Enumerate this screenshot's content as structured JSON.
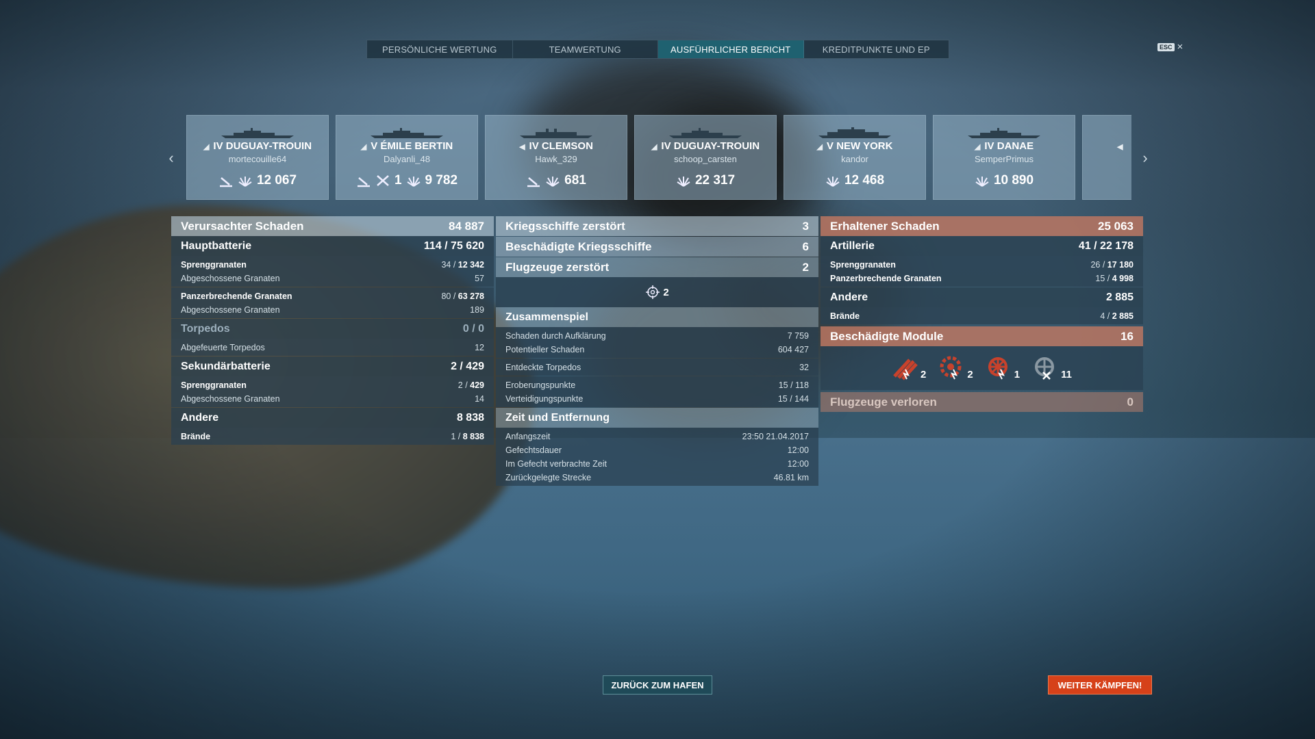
{
  "tabs": [
    {
      "label": "PERSÖNLICHE WERTUNG"
    },
    {
      "label": "TEAMWERTUNG"
    },
    {
      "label": "AUSFÜHRLICHER BERICHT",
      "active": true
    },
    {
      "label": "KREDITPUNKTE UND EP"
    }
  ],
  "esc_label": "ESC",
  "close_icon": "×",
  "cards": [
    {
      "tier": "IV",
      "name": "DUGUAY-TROUIN",
      "player": "mortecouille64",
      "damage": "12 067",
      "icons": [
        "torpedo-hit-icon"
      ]
    },
    {
      "tier": "V",
      "name": "ÉMILE BERTIN",
      "player": "Dalyanli_48",
      "damage": "9 782",
      "icons": [
        "torpedo-hit-icon"
      ],
      "kills": "1"
    },
    {
      "tier": "IV",
      "name": "CLEMSON",
      "player": "Hawk_329",
      "damage": "681",
      "icons": [
        "torpedo-hit-icon"
      ]
    },
    {
      "tier": "IV",
      "name": "DUGUAY-TROUIN",
      "player": "schoop_carsten",
      "damage": "22 317",
      "icons": []
    },
    {
      "tier": "V",
      "name": "NEW YORK",
      "player": "kandor",
      "damage": "12 468",
      "icons": []
    },
    {
      "tier": "IV",
      "name": "DANAE",
      "player": "SemperPrimus",
      "damage": "10 890",
      "icons": []
    }
  ],
  "left": {
    "dealt": {
      "label": "Verursachter Schaden",
      "value": "84 887"
    },
    "main": {
      "label": "Hauptbatterie",
      "value": "114 / 75 620"
    },
    "main_he": {
      "label": "Sprenggranaten",
      "a": "34 / ",
      "b": "12 342"
    },
    "main_he_fired": {
      "label": "Abgeschossene Granaten",
      "value": "57"
    },
    "main_ap": {
      "label": "Panzerbrechende Granaten",
      "a": "80 / ",
      "b": "63 278"
    },
    "main_ap_fired": {
      "label": "Abgeschossene Granaten",
      "value": "189"
    },
    "torp": {
      "label": "Torpedos",
      "value": "0 / 0"
    },
    "torp_fired": {
      "label": "Abgefeuerte Torpedos",
      "value": "12"
    },
    "sec": {
      "label": "Sekundärbatterie",
      "value": "2 / 429"
    },
    "sec_he": {
      "label": "Sprenggranaten",
      "a": "2 / ",
      "b": "429"
    },
    "sec_fired": {
      "label": "Abgeschossene Granaten",
      "value": "14"
    },
    "other": {
      "label": "Andere",
      "value": "8 838"
    },
    "fires": {
      "label": "Brände",
      "a": "1 / ",
      "b": "8 838"
    }
  },
  "mid": {
    "destroyed": {
      "label": "Kriegsschiffe zerstört",
      "value": "3"
    },
    "damaged": {
      "label": "Beschädigte Kriegsschiffe",
      "value": "6"
    },
    "planes": {
      "label": "Flugzeuge zerstört",
      "value": "2"
    },
    "planes_icon_count": "2",
    "team": {
      "label": "Zusammenspiel"
    },
    "team_rows": [
      {
        "label": "Schaden durch Aufklärung",
        "value": "7 759"
      },
      {
        "label": "Potentieller Schaden",
        "value": "604 427"
      }
    ],
    "spotted": {
      "label": "Entdeckte Torpedos",
      "value": "32"
    },
    "cap_rows": [
      {
        "label": "Eroberungspunkte",
        "value": "15 / 118"
      },
      {
        "label": "Verteidigungspunkte",
        "value": "15 / 144"
      }
    ],
    "time": {
      "label": "Zeit und Entfernung"
    },
    "time_rows": [
      {
        "label": "Anfangszeit",
        "value": "23:50  21.04.2017"
      },
      {
        "label": "Gefechtsdauer",
        "value": "12:00"
      },
      {
        "label": "Im Gefecht verbrachte Zeit",
        "value": "12:00"
      },
      {
        "label": "Zurückgelegte Strecke",
        "value": "46.81 km"
      }
    ]
  },
  "right": {
    "received": {
      "label": "Erhaltener Schaden",
      "value": "25 063"
    },
    "art": {
      "label": "Artillerie",
      "value": "41 / 22 178"
    },
    "art_he": {
      "label": "Sprenggranaten",
      "a": "26 / ",
      "b": "17 180"
    },
    "art_ap": {
      "label": "Panzerbrechende Granaten",
      "a": "15 / ",
      "b": "4 998"
    },
    "other": {
      "label": "Andere",
      "value": "2 885"
    },
    "fires": {
      "label": "Brände",
      "a": "4 / ",
      "b": "2 885"
    },
    "modules": {
      "label": "Beschädigte Module",
      "value": "16"
    },
    "module_counts": [
      {
        "icon": "gun-module-icon",
        "count": "2"
      },
      {
        "icon": "engine-module-icon",
        "count": "2"
      },
      {
        "icon": "steering-module-icon",
        "count": "1"
      },
      {
        "icon": "disabled-module-icon",
        "count": "11"
      }
    ],
    "planes_lost": {
      "label": "Flugzeuge verloren",
      "value": "0"
    }
  },
  "buttons": {
    "port": "ZURÜCK ZUM HAFEN",
    "fight": "WEITER KÄMPFEN!"
  }
}
